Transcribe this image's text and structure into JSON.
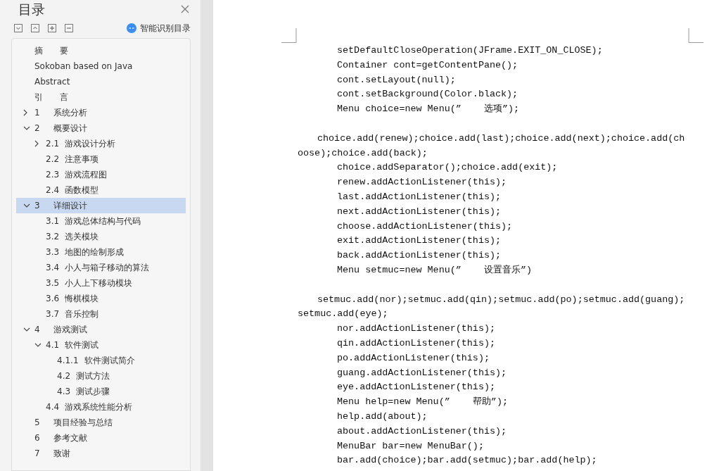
{
  "sidebar": {
    "title": "目录",
    "smart_toc": "智能识别目录",
    "toc": [
      {
        "label": "摘　　要",
        "selected": false
      },
      {
        "label": "Sokoban based on Java",
        "selected": false
      },
      {
        "label": "Abstract",
        "selected": false
      },
      {
        "label": "引　　言",
        "selected": false
      },
      {
        "number": "1",
        "label": "系统分析",
        "expanded": false,
        "selected": false,
        "has_children": true
      },
      {
        "number": "2",
        "label": "概要设计",
        "expanded": true,
        "selected": false,
        "children": [
          {
            "number": "2.1",
            "label": "游戏设计分析",
            "expanded": false,
            "selected": false,
            "has_children": true
          },
          {
            "number": "2.2",
            "label": "注意事项",
            "selected": false
          },
          {
            "number": "2.3",
            "label": "游戏流程图",
            "selected": false
          },
          {
            "number": "2.4",
            "label": "函数模型",
            "selected": false
          }
        ]
      },
      {
        "number": "3",
        "label": "详细设计",
        "expanded": true,
        "selected": true,
        "children": [
          {
            "number": "3.1",
            "label": "游戏总体结构与代码",
            "selected": false
          },
          {
            "number": "3.2",
            "label": "选关模块",
            "selected": false
          },
          {
            "number": "3.3",
            "label": "地图的绘制形成",
            "selected": false
          },
          {
            "number": "3.4",
            "label": "小人与箱子移动的算法",
            "selected": false
          },
          {
            "number": "3.5",
            "label": "小人上下移动模块",
            "selected": false
          },
          {
            "number": "3.6",
            "label": "悔棋模块",
            "selected": false
          },
          {
            "number": "3.7",
            "label": "音乐控制",
            "selected": false
          }
        ]
      },
      {
        "number": "4",
        "label": "游戏测试",
        "expanded": true,
        "selected": false,
        "children": [
          {
            "number": "4.1",
            "label": "软件测试",
            "expanded": true,
            "selected": false,
            "children": [
              {
                "number": "4.1.1",
                "label": "软件测试简介",
                "selected": false
              },
              {
                "number": "4.2",
                "label": "测试方法",
                "selected": false
              },
              {
                "number": "4.3",
                "label": "测试步骤",
                "selected": false
              }
            ]
          },
          {
            "number": "4.4",
            "label": "游戏系统性能分析",
            "selected": false
          }
        ]
      },
      {
        "number": "5",
        "label": "项目经验与总结",
        "selected": false
      },
      {
        "number": "6",
        "label": "参考文献",
        "selected": false
      },
      {
        "number": "7",
        "label": "致谢",
        "selected": false
      }
    ]
  },
  "document": {
    "paragraphs": [
      {
        "kind": "code",
        "text": "setDefaultCloseOperation(JFrame.EXIT_ON_CLOSE);"
      },
      {
        "kind": "code",
        "text": "Container cont=getContentPane();"
      },
      {
        "kind": "code",
        "text": "cont.setLayout(null);"
      },
      {
        "kind": "code",
        "text": "cont.setBackground(Color.black);"
      },
      {
        "kind": "code",
        "text": "Menu choice=new Menu(”    选项”);"
      },
      {
        "kind": "wrapped",
        "text": "choice.add(renew);choice.add(last);choice.add(next);choice.add(choose);choice.add(back);"
      },
      {
        "kind": "code",
        "text": "choice.addSeparator();choice.add(exit);"
      },
      {
        "kind": "code",
        "text": "renew.addActionListener(this);"
      },
      {
        "kind": "code",
        "text": "last.addActionListener(this);"
      },
      {
        "kind": "code",
        "text": "next.addActionListener(this);"
      },
      {
        "kind": "code",
        "text": "choose.addActionListener(this);"
      },
      {
        "kind": "code",
        "text": "exit.addActionListener(this);"
      },
      {
        "kind": "code",
        "text": "back.addActionListener(this);"
      },
      {
        "kind": "code",
        "text": "Menu setmuc=new Menu(”    设置音乐”)"
      },
      {
        "kind": "wrapped",
        "text": "setmuc.add(nor);setmuc.add(qin);setmuc.add(po);setmuc.add(guang);setmuc.add(eye);"
      },
      {
        "kind": "code",
        "text": "nor.addActionListener(this);"
      },
      {
        "kind": "code",
        "text": "qin.addActionListener(this);"
      },
      {
        "kind": "code",
        "text": "po.addActionListener(this);"
      },
      {
        "kind": "code",
        "text": "guang.addActionListener(this);"
      },
      {
        "kind": "code",
        "text": "eye.addActionListener(this);"
      },
      {
        "kind": "code",
        "text": "Menu help=new Menu(”    帮助”);"
      },
      {
        "kind": "code",
        "text": "help.add(about);"
      },
      {
        "kind": "code",
        "text": "about.addActionListener(this);"
      },
      {
        "kind": "code",
        "text": "MenuBar bar=new MenuBar();"
      },
      {
        "kind": "code",
        "text": "bar.add(choice);bar.add(setmuc);bar.add(help);"
      }
    ]
  }
}
